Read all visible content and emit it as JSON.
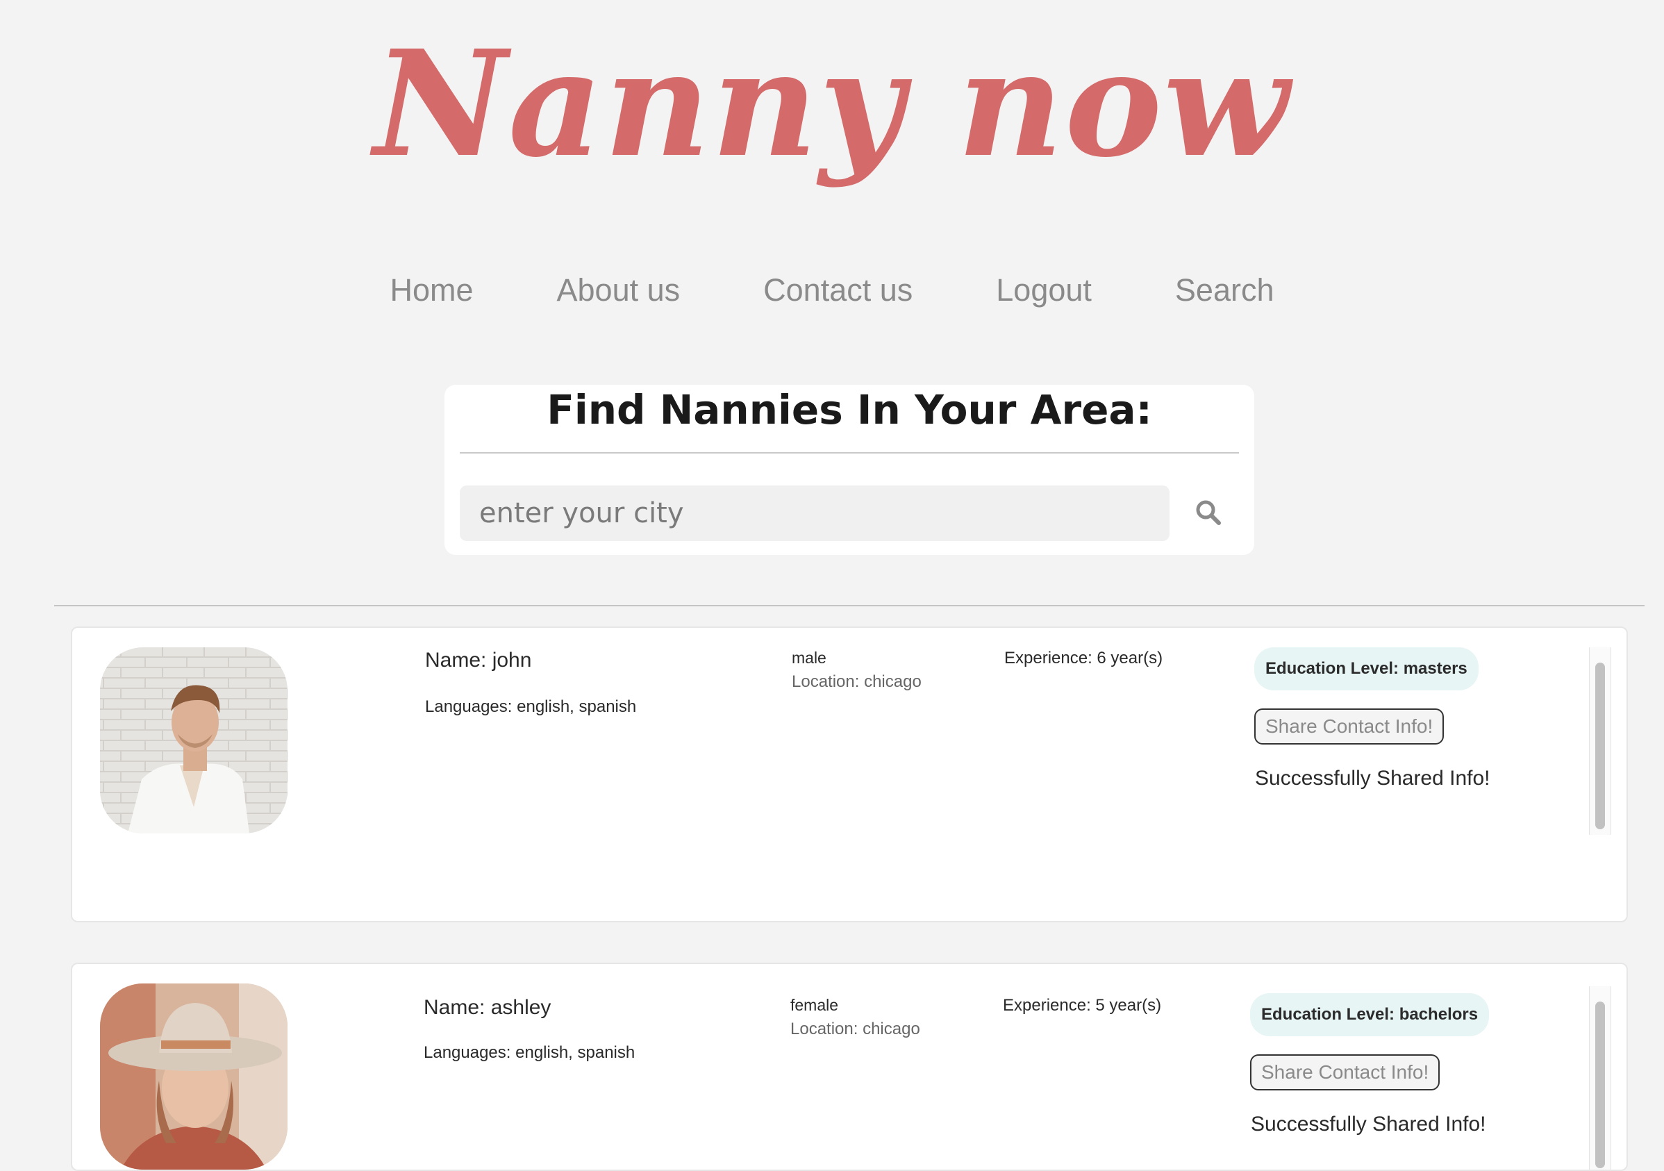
{
  "header": {
    "logo_text": "Nanny now",
    "logo_color": "#d46a6a"
  },
  "nav": {
    "items": [
      {
        "label": "Home"
      },
      {
        "label": "About us"
      },
      {
        "label": "Contact us"
      },
      {
        "label": "Logout"
      },
      {
        "label": "Search"
      }
    ]
  },
  "search": {
    "title": "Find Nannies In Your Area:",
    "placeholder": "enter your city",
    "button_icon": "search-icon"
  },
  "results": [
    {
      "name": "Name: john",
      "languages": "Languages: english, spanish",
      "gender": "male",
      "location": "Location: chicago",
      "experience": "Experience: 6 year(s)",
      "education": "Education Level: masters",
      "share_label": "Share Contact Info!",
      "status_message": "Successfully Shared Info!"
    },
    {
      "name": "Name: ashley",
      "languages": "Languages: english, spanish",
      "gender": "female",
      "location": "Location: chicago",
      "experience": "Experience: 5 year(s)",
      "education": "Education Level: bachelors",
      "share_label": "Share Contact Info!",
      "status_message": "Successfully Shared Info!"
    }
  ],
  "colors": {
    "page_background": "#f3f3f3",
    "badge_background": "#e7f5f5",
    "nav_text": "#8a8a8a"
  }
}
